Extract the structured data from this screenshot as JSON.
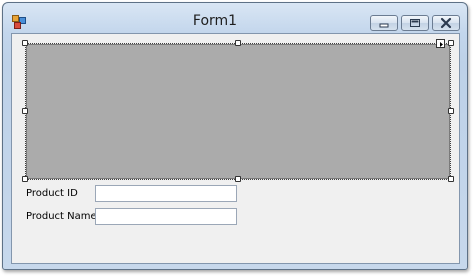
{
  "window": {
    "title": "Form1",
    "title_icon": "form-app-icon",
    "caption_buttons": [
      "minimize-icon",
      "maximize-icon",
      "close-icon"
    ]
  },
  "form": {
    "fields": [
      {
        "label": "Product ID",
        "value": ""
      },
      {
        "label": "Product Name",
        "value": ""
      }
    ]
  },
  "colors": {
    "grid_fill": "#ababab",
    "form_background": "#f0f0f0",
    "title_bar": "#c3d6ec"
  }
}
